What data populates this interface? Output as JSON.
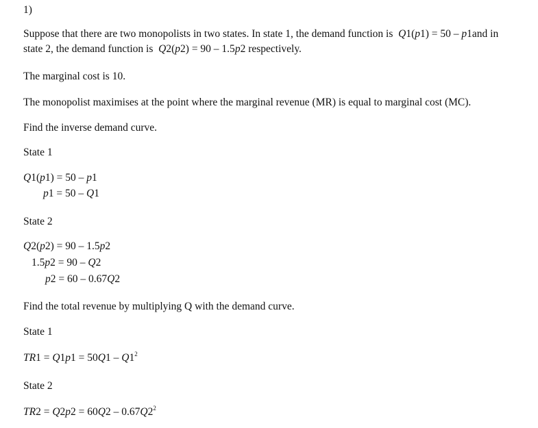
{
  "question_number": "1)",
  "intro": {
    "line1_text": "Suppose that there are two monopolists in two states. In state 1, the demand function is",
    "line1_eq": {
      "Q": "Q",
      "i": "1(",
      "p": "p",
      "j": "1) = 50 – ",
      "p2": "p",
      "k": "1"
    },
    "line1_tail": "and in",
    "line2_text": "state 2, the demand function is",
    "line2_eq": {
      "a": "Q",
      "b": "2(",
      "c": "p",
      "d": "2) = 90 – 1.5",
      "e": "p",
      "f": "2"
    },
    "line2_tail": "respectively."
  },
  "marginal_cost_text": "The marginal cost is 10.",
  "maximisation_text": "The monopolist maximises at the point where the marginal revenue (MR) is equal to marginal cost (MC).",
  "inverse_heading": "Find the inverse demand curve.",
  "state1_label": "State 1",
  "state1_eqs": {
    "eq1": {
      "a": "Q",
      "b": "1(",
      "c": "p",
      "d": "1) = 50 – ",
      "e": "p",
      "f": "1"
    },
    "eq2": {
      "a": "p",
      "b": "1 = 50 – ",
      "c": "Q",
      "d": "1"
    }
  },
  "state2_label": "State 2",
  "state2_eqs": {
    "eq1": {
      "a": "Q",
      "b": "2(",
      "c": "p",
      "d": "2) = 90 – 1.5",
      "e": "p",
      "f": "2"
    },
    "eq2": {
      "a": "1.5",
      "b": "p",
      "c": "2 = 90 – ",
      "d": "Q",
      "e": "2"
    },
    "eq3": {
      "a": "p",
      "b": "2 = 60 – 0.67",
      "c": "Q",
      "d": "2"
    }
  },
  "revenue_heading": "Find the total revenue by multiplying Q with the demand curve.",
  "tr_state1_label": "State 1",
  "tr1": {
    "a": "TR",
    "b": "1 = ",
    "c": "Q",
    "d": "1",
    "e": "p",
    "f": "1 = 50",
    "g": "Q",
    "h": "1 – ",
    "i": "Q",
    "j": "1",
    "sup": "2"
  },
  "tr_state2_label": "State 2",
  "tr2": {
    "a": "TR",
    "b": "2 = ",
    "c": "Q",
    "d": "2",
    "e": "p",
    "f": "2 = 60",
    "g": "Q",
    "h": "2 – 0.67",
    "i": "Q",
    "j": "2",
    "sup": "2"
  }
}
